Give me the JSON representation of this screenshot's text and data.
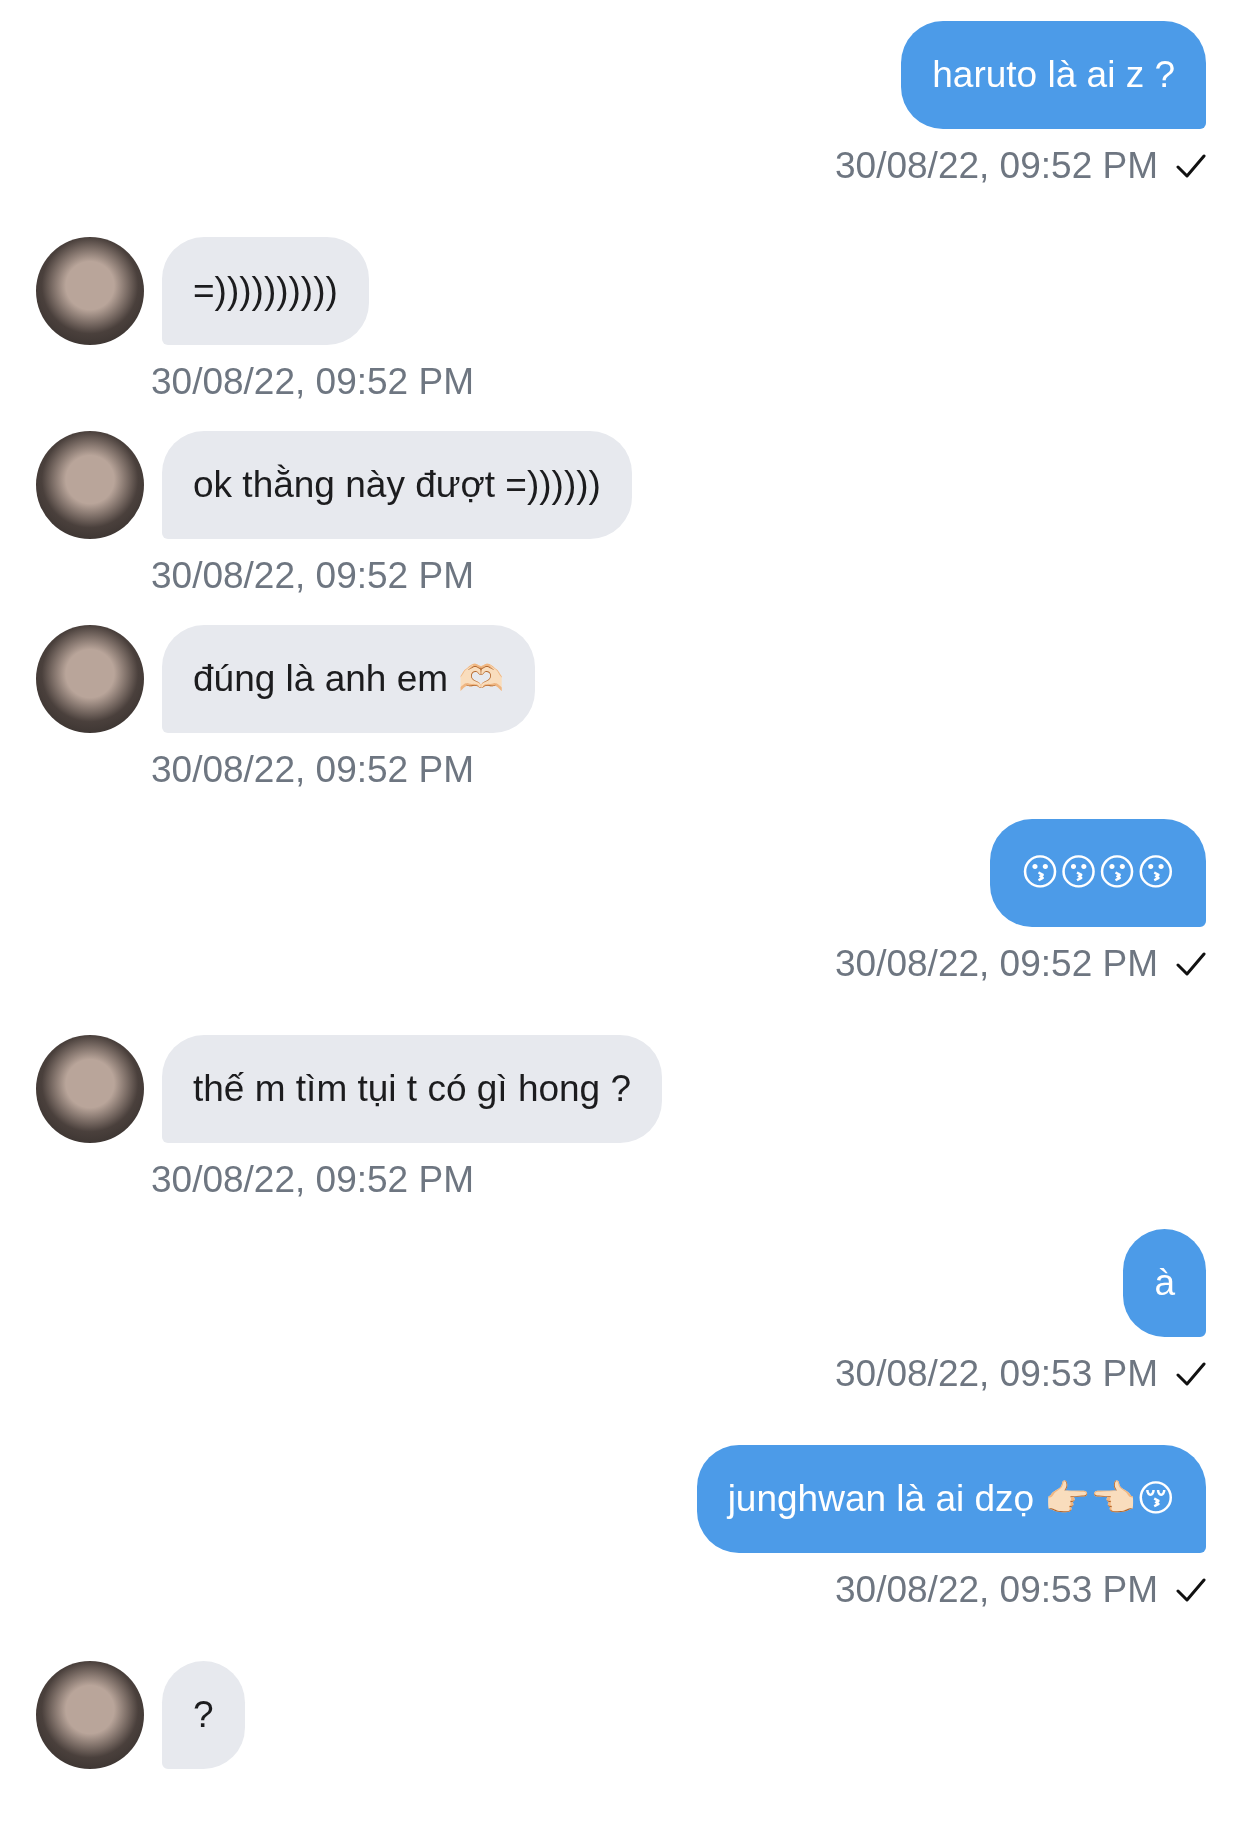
{
  "messages": [
    {
      "kind": "sent",
      "text": "haruto là ai z ?",
      "time": "30/08/22, 09:52 PM",
      "delivered": true
    },
    {
      "kind": "received",
      "text": "=))))))))))",
      "time": "30/08/22, 09:52 PM"
    },
    {
      "kind": "received",
      "text": "ok thằng này đượt =))))))",
      "time": "30/08/22, 09:52 PM"
    },
    {
      "kind": "received",
      "text": "đúng là anh em 🫶🏻",
      "time": "30/08/22, 09:52 PM"
    },
    {
      "kind": "sent",
      "text": "😗😗😗😗",
      "time": "30/08/22, 09:52 PM",
      "delivered": true
    },
    {
      "kind": "received",
      "text": "thế m tìm tụi t có gì hong ?",
      "time": "30/08/22, 09:52 PM"
    },
    {
      "kind": "sent",
      "text": "à",
      "time": "30/08/22, 09:53 PM",
      "delivered": true
    },
    {
      "kind": "sent",
      "text": "junghwan là ai dzọ 👉🏻👈🏻😚",
      "time": "30/08/22, 09:53 PM",
      "delivered": true
    },
    {
      "kind": "received",
      "text": "?"
    }
  ]
}
